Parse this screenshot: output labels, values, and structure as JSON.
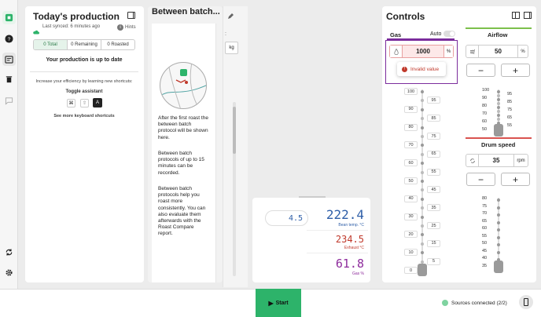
{
  "production": {
    "title": "Today's production",
    "sync": "Last synced: 6 minutes ago",
    "hints": "Hints",
    "tabs": [
      "0 Total",
      "0 Remaining",
      "0 Roasted"
    ],
    "status": "Your production is up to date",
    "efficiency": "Increase your efficiency by learning new shortcuts:",
    "toggle": "Toggle assistant",
    "keys": [
      "⌘",
      "⇧",
      "A"
    ],
    "more": "See more keyboard shortcuts"
  },
  "between": {
    "title": "Between batch...",
    "p1": "After the first roast the between batch protocol will be shown here.",
    "p2": "Between batch protocols of up to 15 minutes can be recorded.",
    "p3": "Between batch protocols help you roast more consistently. You can also evaluate them afterwards with the Roast Compare report.",
    "unit": "kg",
    "colon": ":"
  },
  "readings": {
    "input_value": "4.5",
    "bean_temp": "222.4",
    "bean_label": "Bean temp. °C",
    "exhaust": "234.5",
    "exhaust_label": "Exhaust °C",
    "gas": "61.8",
    "gas_label": "Gas %"
  },
  "controls": {
    "title": "Controls",
    "gas": {
      "label": "Gas",
      "auto": "Auto",
      "value": "1000",
      "unit": "%",
      "error": "Invalid value",
      "ticks_left": [
        "100",
        "90",
        "80",
        "70",
        "60",
        "50",
        "40",
        "30",
        "20",
        "10",
        "0"
      ],
      "ticks_right": [
        "95",
        "85",
        "75",
        "65",
        "55",
        "45",
        "35",
        "25",
        "15",
        "5"
      ]
    },
    "airflow": {
      "label": "Airflow",
      "value": "50",
      "unit": "%",
      "minus": "−",
      "plus": "+",
      "ticks_left": [
        "100",
        "90",
        "80",
        "70",
        "60",
        "50"
      ],
      "ticks_right": [
        "95",
        "85",
        "75",
        "65",
        "55"
      ]
    },
    "drum": {
      "label": "Drum speed",
      "value": "35",
      "unit": "rpm",
      "minus": "−",
      "plus": "+",
      "ticks": [
        "80",
        "75",
        "70",
        "65",
        "60",
        "55",
        "50",
        "45",
        "40",
        "35"
      ]
    }
  },
  "footer": {
    "start": "Start",
    "sources": "Sources connected (2/2)"
  },
  "colors": {
    "gas": "#7b2c9c",
    "airflow": "#7cc04b",
    "drum": "#d9534f",
    "accent": "#2db36a",
    "bean": "#2f5fa8",
    "exhaust": "#c0392b",
    "gas_reading": "#8e2c9c"
  }
}
